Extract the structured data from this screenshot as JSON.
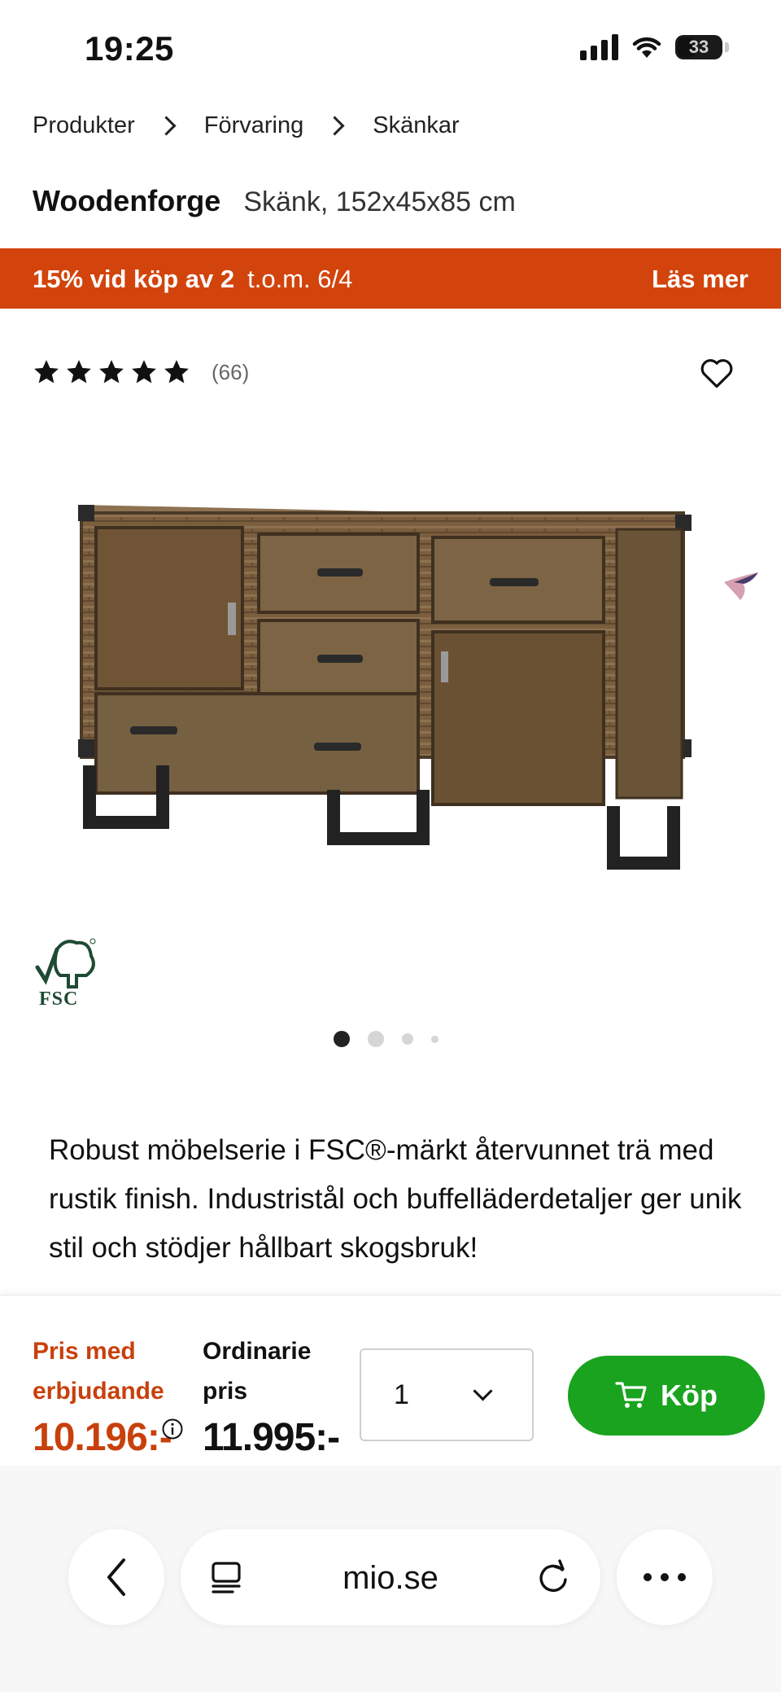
{
  "status": {
    "time": "19:25",
    "battery": "33"
  },
  "breadcrumb": [
    "Produkter",
    "Förvaring",
    "Skänkar"
  ],
  "product": {
    "brand": "Woodenforge",
    "name": "Skänk, 152x45x85 cm",
    "rating": 5,
    "review_count": "(66)",
    "certification": "FSC",
    "description": "Robust möbelserie i FSC®-märkt återvunnet trä med rustik finish. Industristål och buffelläderdetaljer ger unik stil och stödjer hållbart skogsbruk!"
  },
  "promo": {
    "offer": "15% vid köp av 2",
    "until": "t.o.m. 6/4",
    "link": "Läs mer"
  },
  "carousel": {
    "count": 4,
    "active": 0
  },
  "buy": {
    "offer_label": "Pris med erbjudande",
    "offer_price": "10.196:-",
    "regular_label": "Ordinarie pris",
    "regular_price": "11.995:-",
    "quantity": "1",
    "button_label": "Köp"
  },
  "browser": {
    "url": "mio.se"
  },
  "colors": {
    "promo": "#d2440b",
    "offer": "#c8400c",
    "buy": "#1aa31f"
  }
}
